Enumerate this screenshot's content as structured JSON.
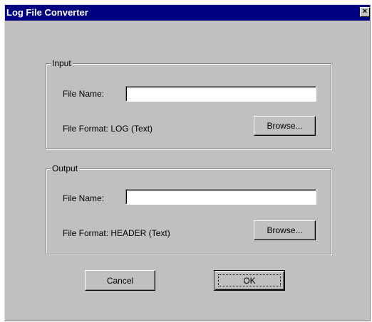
{
  "window": {
    "title": "Log File Converter",
    "close_glyph": "×",
    "close_icon": "close-icon"
  },
  "input": {
    "group_label": "Input",
    "file_name_label": "File Name:",
    "file_name_value": "",
    "file_format_text": "File Format:  LOG (Text)",
    "browse_label": "Browse..."
  },
  "output": {
    "group_label": "Output",
    "file_name_label": "File Name:",
    "file_name_value": "",
    "file_format_text": "File Format: HEADER (Text)",
    "browse_label": "Browse..."
  },
  "buttons": {
    "cancel_label": "Cancel",
    "ok_label": "OK"
  },
  "colors": {
    "titlebar": "#000080",
    "face": "#c0c0c0"
  }
}
